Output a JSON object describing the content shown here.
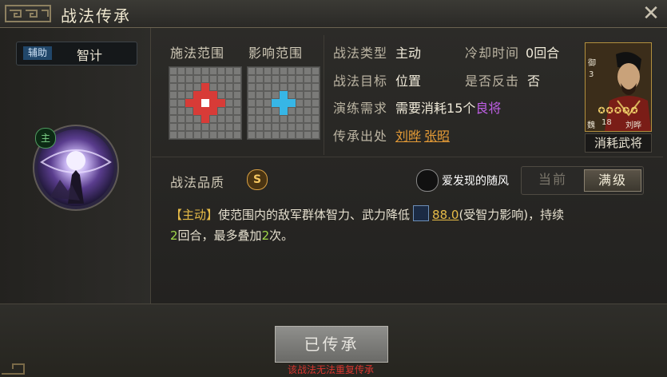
{
  "window": {
    "title": "战法传承",
    "close_label": "✕"
  },
  "skill": {
    "type_badge": "辅助",
    "name": "智计",
    "badge": "主"
  },
  "range": {
    "cast_label": "施法范围",
    "effect_label": "影响范围",
    "cast_color": "#d83b37",
    "effect_color": "#37b6e6"
  },
  "info": {
    "type_label": "战法类型",
    "type_value": "主动",
    "cooldown_label": "冷却时间",
    "cooldown_value": "0回合",
    "target_label": "战法目标",
    "target_value": "位置",
    "counter_label": "是否反击",
    "counter_value": "否",
    "train_label": "演练需求",
    "train_prefix": "需要消耗",
    "train_count": "15个",
    "train_item": "良将",
    "source_label": "传承出处",
    "source_1": "刘晔",
    "source_2": "张昭"
  },
  "general_card": {
    "rank_char": "御",
    "rank_num": "3",
    "faction": "魏",
    "level": "18",
    "name": "刘晔",
    "stars": 5,
    "consume_label": "消耗武将"
  },
  "quality": {
    "label": "战法品质",
    "grade": "S"
  },
  "watermark": {
    "text": "爱发现的随风"
  },
  "level_toggle": {
    "current_label": "当前",
    "max_label": "满级",
    "selected": "满级"
  },
  "description": {
    "tag": "【主动】",
    "part1": "使范围内的敌军群体智力、武力降低",
    "value": "88.0",
    "part2": "(受智力影响)，持续",
    "turns": "2",
    "part3": "回合，最多叠加",
    "stacks": "2",
    "part4": "次。"
  },
  "action": {
    "button_label": "已传承",
    "warning": "该战法无法重复传承"
  }
}
